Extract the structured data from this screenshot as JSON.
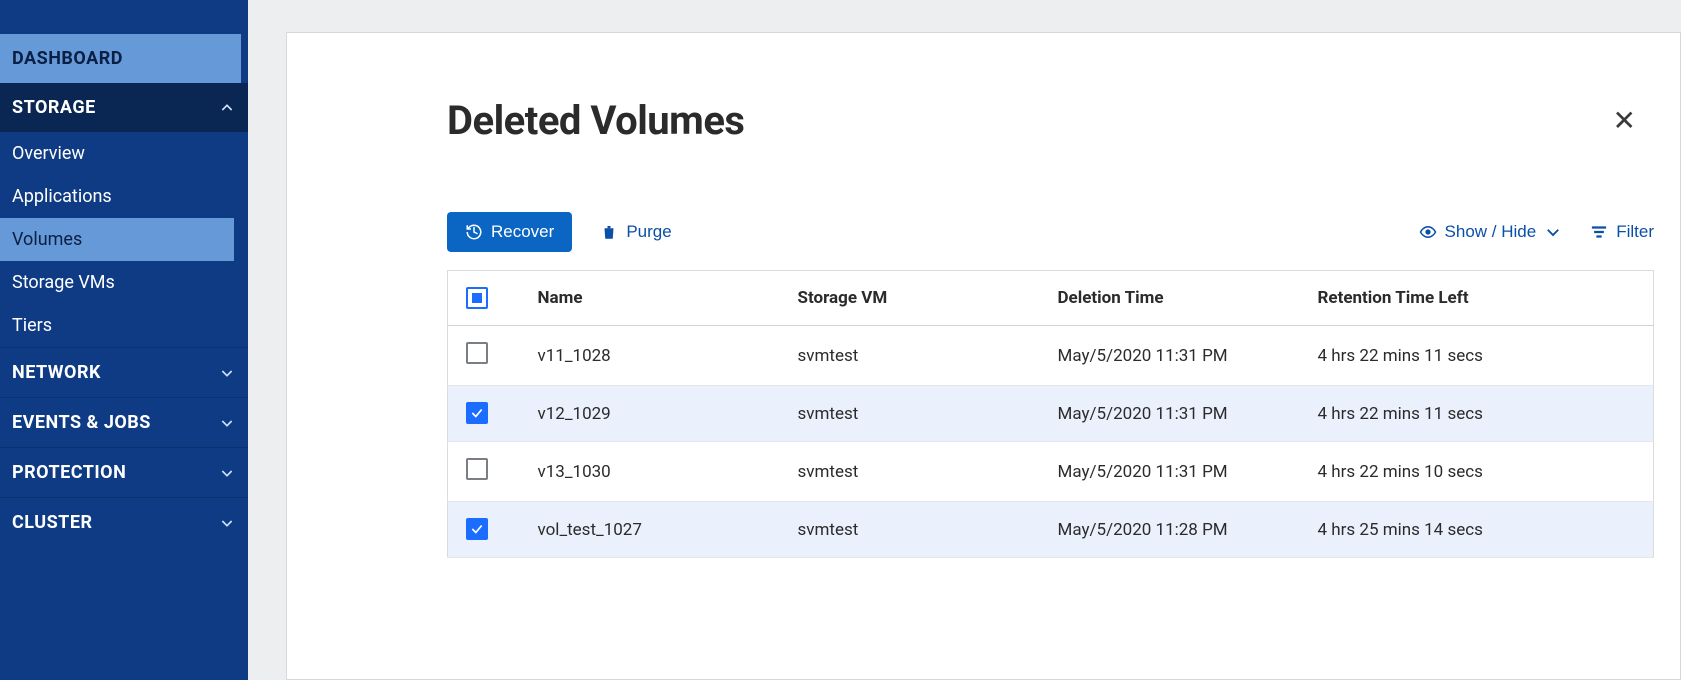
{
  "sidebar": {
    "dashboard": "DASHBOARD",
    "storage": {
      "label": "STORAGE",
      "items": [
        "Overview",
        "Applications",
        "Volumes",
        "Storage VMs",
        "Tiers"
      ]
    },
    "network": "NETWORK",
    "events_jobs": "EVENTS & JOBS",
    "protection": "PROTECTION",
    "cluster": "CLUSTER"
  },
  "page": {
    "title": "Deleted Volumes"
  },
  "toolbar": {
    "recover": "Recover",
    "purge": "Purge",
    "show_hide": "Show / Hide",
    "filter": "Filter"
  },
  "table": {
    "headers": {
      "name": "Name",
      "svm": "Storage VM",
      "deletion": "Deletion Time",
      "retention": "Retention Time Left"
    },
    "rows": [
      {
        "checked": false,
        "name": "v11_1028",
        "svm": "svmtest",
        "deletion": "May/5/2020 11:31 PM",
        "retention": "4 hrs 22 mins 11 secs"
      },
      {
        "checked": true,
        "name": "v12_1029",
        "svm": "svmtest",
        "deletion": "May/5/2020 11:31 PM",
        "retention": "4 hrs 22 mins 11 secs"
      },
      {
        "checked": false,
        "name": "v13_1030",
        "svm": "svmtest",
        "deletion": "May/5/2020 11:31 PM",
        "retention": "4 hrs 22 mins 10 secs"
      },
      {
        "checked": true,
        "name": "vol_test_1027",
        "svm": "svmtest",
        "deletion": "May/5/2020 11:28 PM",
        "retention": "4 hrs 25 mins 14 secs"
      }
    ]
  }
}
